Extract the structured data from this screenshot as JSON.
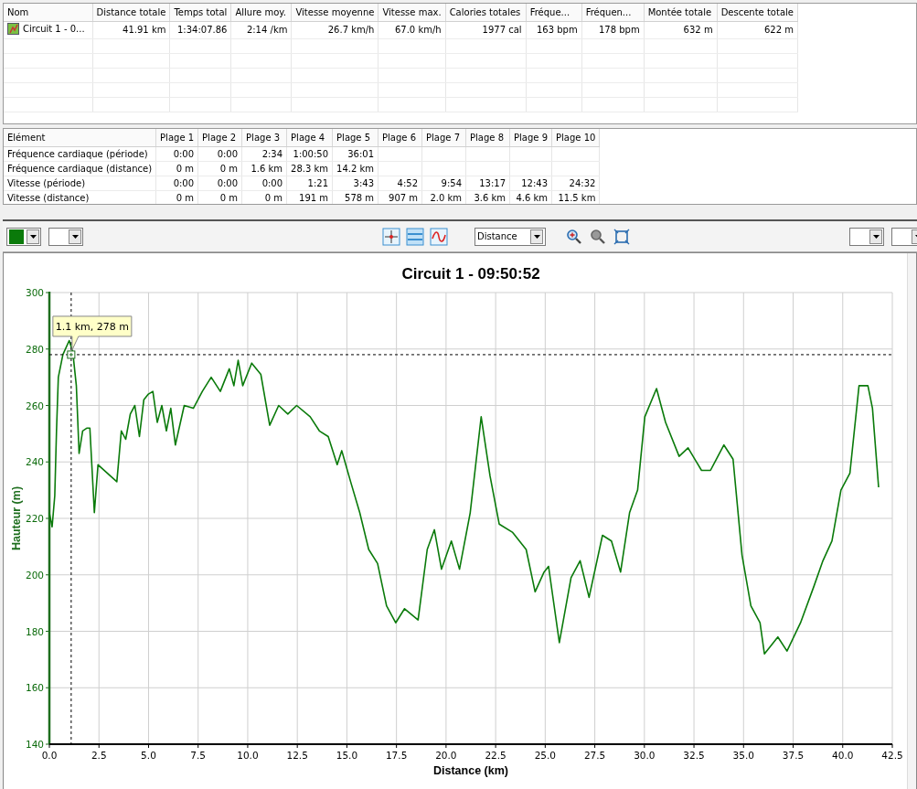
{
  "summary_table": {
    "columns": [
      "Nom",
      "Distance totale",
      "Temps total",
      "Allure moy.",
      "Vitesse moyenne",
      "Vitesse max.",
      "Calories totales",
      "Fréque...",
      "Fréquen...",
      "Montée totale",
      "Descente totale"
    ],
    "rows": [
      [
        "Circuit 1 - 0...",
        "41.91 km",
        "1:34:07.86",
        "2:14 /km",
        "26.7 km/h",
        "67.0 km/h",
        "1977 cal",
        "163 bpm",
        "178 bpm",
        "632 m",
        "622 m"
      ]
    ]
  },
  "zones_table": {
    "columns": [
      "Elément",
      "Plage 1",
      "Plage 2",
      "Plage 3",
      "Plage 4",
      "Plage 5",
      "Plage 6",
      "Plage 7",
      "Plage 8",
      "Plage 9",
      "Plage 10"
    ],
    "rows": [
      [
        "Fréquence cardiaque (période)",
        "0:00",
        "0:00",
        "2:34",
        "1:00:50",
        "36:01",
        "",
        "",
        "",
        "",
        ""
      ],
      [
        "Fréquence cardiaque (distance)",
        "0 m",
        "0 m",
        "1.6 km",
        "28.3 km",
        "14.2 km",
        "",
        "",
        "",
        "",
        ""
      ],
      [
        "Vitesse (période)",
        "0:00",
        "0:00",
        "0:00",
        "1:21",
        "3:43",
        "4:52",
        "9:54",
        "13:17",
        "12:43",
        "24:32"
      ],
      [
        "Vitesse (distance)",
        "0 m",
        "0 m",
        "0 m",
        "191 m",
        "578 m",
        "907 m",
        "2.0 km",
        "3.6 km",
        "4.6 km",
        "11.5 km"
      ]
    ]
  },
  "toolbar": {
    "x_axis_select": "Distance"
  },
  "chart": {
    "chart_data": {
      "type": "line",
      "title": "Circuit 1 - 09:50:52",
      "xlabel": "Distance (km)",
      "ylabel": "Hauteur (m)",
      "xlim": [
        0,
        42.5
      ],
      "ylim": [
        140,
        300
      ],
      "grid": true,
      "ref_lines": [
        {
          "axis": "x",
          "value": 1.1
        },
        {
          "axis": "y",
          "value": 278
        }
      ],
      "xticks": [
        {
          "value": 0,
          "label": "0.0"
        },
        {
          "value": 2.5,
          "label": "2.5"
        },
        {
          "value": 5,
          "label": "5.0"
        },
        {
          "value": 7.5,
          "label": "7.5"
        },
        {
          "value": 10,
          "label": "10.0"
        },
        {
          "value": 12.5,
          "label": "12.5"
        },
        {
          "value": 15,
          "label": "15.0"
        },
        {
          "value": 17.5,
          "label": "17.5"
        },
        {
          "value": 20,
          "label": "20.0"
        },
        {
          "value": 22.5,
          "label": "22.5"
        },
        {
          "value": 25,
          "label": "25.0"
        },
        {
          "value": 27.5,
          "label": "27.5"
        },
        {
          "value": 30,
          "label": "30.0"
        },
        {
          "value": 32.5,
          "label": "32.5"
        },
        {
          "value": 35,
          "label": "35.0"
        },
        {
          "value": 37.5,
          "label": "37.5"
        },
        {
          "value": 40,
          "label": "40.0"
        },
        {
          "value": 42.5,
          "label": "42.5"
        }
      ],
      "yticks": [
        140,
        160,
        180,
        200,
        220,
        240,
        260,
        280,
        300
      ],
      "x": [
        0,
        0.14,
        0.27,
        0.36,
        0.45,
        0.68,
        1.0,
        1.18,
        1.36,
        1.5,
        1.68,
        1.9,
        2.04,
        2.27,
        2.45,
        3.08,
        3.4,
        3.63,
        3.85,
        4.08,
        4.31,
        4.54,
        4.76,
        4.99,
        5.22,
        5.44,
        5.67,
        5.9,
        6.12,
        6.35,
        6.8,
        7.26,
        7.71,
        8.16,
        8.62,
        9.07,
        9.3,
        9.52,
        9.75,
        10.2,
        10.66,
        11.11,
        11.56,
        12.02,
        12.47,
        13.15,
        13.61,
        14.06,
        14.51,
        14.74,
        15.19,
        15.65,
        16.1,
        16.55,
        17.0,
        17.46,
        17.91,
        18.59,
        19.05,
        19.41,
        19.77,
        20.27,
        20.68,
        21.22,
        21.77,
        22.22,
        22.68,
        23.36,
        24.04,
        24.49,
        24.94,
        25.17,
        25.71,
        26.3,
        26.76,
        27.21,
        27.89,
        28.34,
        28.8,
        29.25,
        29.66,
        30.02,
        30.61,
        31.07,
        31.75,
        32.2,
        32.88,
        33.33,
        34.01,
        34.47,
        34.92,
        35.37,
        35.83,
        36.05,
        36.73,
        37.19,
        37.87,
        38.55,
        39.0,
        39.46,
        39.91,
        40.36,
        40.82,
        41.27,
        41.5,
        41.81
      ],
      "series": [
        {
          "color": "#0a7a0a",
          "values": [
            222,
            217,
            228,
            251,
            270,
            278,
            283,
            279,
            267,
            243,
            251,
            252,
            252,
            222,
            239,
            235,
            233,
            251,
            248,
            257,
            260,
            249,
            262,
            264,
            265,
            254,
            260,
            251,
            259,
            246,
            260,
            259,
            265,
            270,
            265,
            273,
            267,
            276,
            267,
            275,
            271,
            253,
            260,
            257,
            260,
            256,
            251,
            249,
            239,
            244,
            233,
            222,
            209,
            204,
            189,
            183,
            188,
            184,
            209,
            216,
            202,
            212,
            202,
            222,
            256,
            235,
            218,
            215,
            209,
            194,
            201,
            203,
            176,
            199,
            205,
            192,
            214,
            212,
            201,
            222,
            230,
            256,
            266,
            254,
            242,
            245,
            237,
            237,
            246,
            241,
            207,
            189,
            183,
            172,
            178,
            173,
            183,
            196,
            205,
            212,
            230,
            236,
            267,
            267,
            259,
            231
          ]
        }
      ],
      "annotations": [
        {
          "x": 1.1,
          "y": 278,
          "text": "1.1 km, 278 m"
        }
      ]
    }
  }
}
